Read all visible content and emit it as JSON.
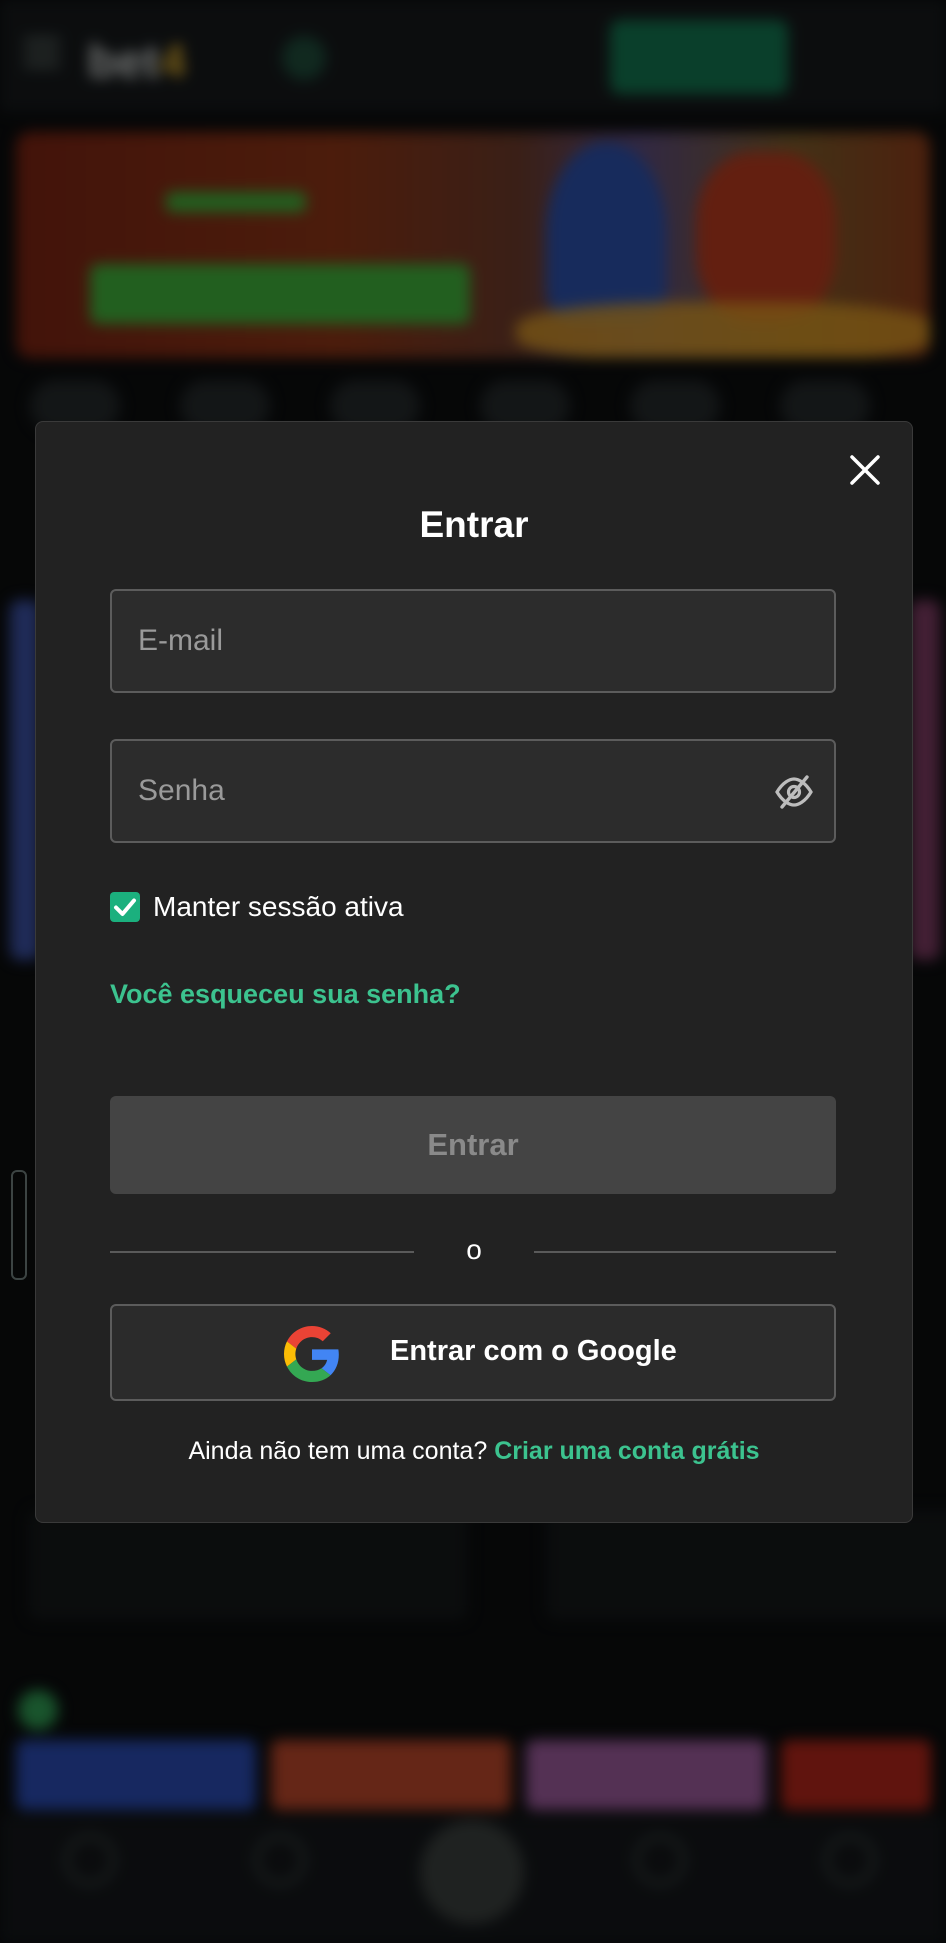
{
  "modal": {
    "title": "Entrar",
    "email_placeholder": "E-mail",
    "password_placeholder": "Senha",
    "remember_label": "Manter sessão ativa",
    "remember_checked": true,
    "forgot_link": "Você esqueceu sua senha?",
    "submit_label": "Entrar",
    "divider_text": "o",
    "google_label": "Entrar com o Google",
    "no_account_text": "Ainda não tem uma conta?",
    "create_account_link": "Criar uma conta grátis"
  },
  "icons": {
    "close": "close-icon",
    "eye": "eye-off-icon",
    "check": "check-icon",
    "google": "google-icon"
  },
  "colors": {
    "accent": "#3cc38f",
    "checkbox": "#1bb07e",
    "modal_bg": "#222222",
    "submit_disabled": "#444444"
  }
}
